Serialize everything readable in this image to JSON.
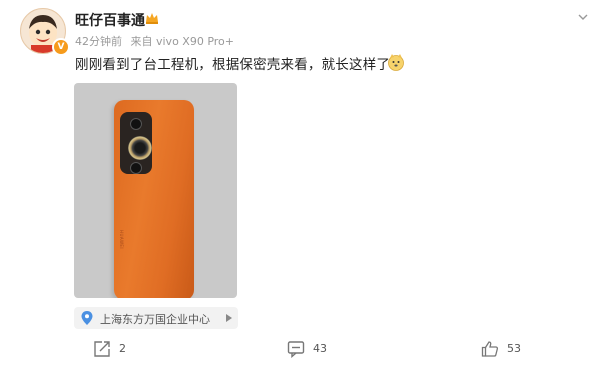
{
  "user": {
    "name": "旺仔百事通",
    "verified_color": "#f69b1c"
  },
  "meta": {
    "time": "42分钟前",
    "source": "来自 vivo X90 Pro+"
  },
  "post": {
    "text": "刚刚看到了台工程机，根据保密壳来看，就长这样了"
  },
  "photo": {
    "phone_brand": "HUAWEI"
  },
  "location": {
    "label": "上海东方万国企业中心"
  },
  "actions": {
    "share_count": "2",
    "comment_count": "43",
    "like_count": "53"
  }
}
